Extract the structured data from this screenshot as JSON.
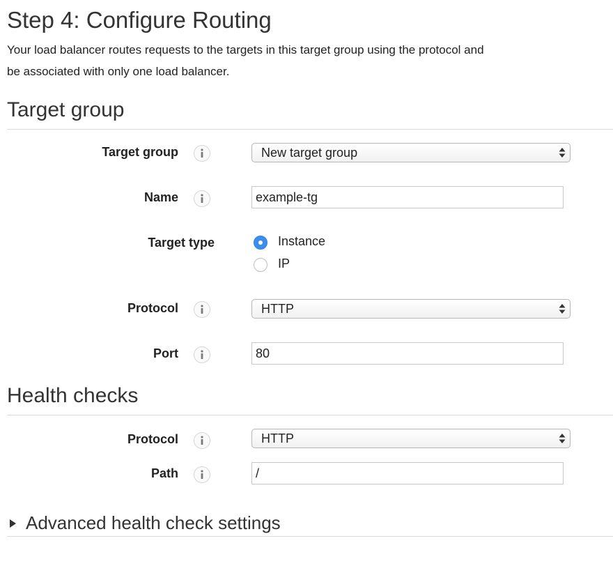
{
  "header": {
    "title": "Step 4: Configure Routing",
    "intro_line1": "Your load balancer routes requests to the targets in this target group using the protocol and",
    "intro_line2": "be associated with only one load balancer."
  },
  "target_group_section": {
    "title": "Target group",
    "target_group": {
      "label": "Target group",
      "value": "New target group"
    },
    "name": {
      "label": "Name",
      "value": "example-tg"
    },
    "target_type": {
      "label": "Target type",
      "options": [
        {
          "label": "Instance",
          "selected": true
        },
        {
          "label": "IP",
          "selected": false
        }
      ]
    },
    "protocol": {
      "label": "Protocol",
      "value": "HTTP"
    },
    "port": {
      "label": "Port",
      "value": "80"
    }
  },
  "health_checks_section": {
    "title": "Health checks",
    "protocol": {
      "label": "Protocol",
      "value": "HTTP"
    },
    "path": {
      "label": "Path",
      "value": "/"
    }
  },
  "advanced": {
    "label": "Advanced health check settings",
    "expanded": false
  },
  "icons": {
    "info": "info-icon",
    "select_arrows": "select-arrows-icon",
    "expand": "caret-right-icon"
  },
  "colors": {
    "accent": "#3b8ef0",
    "text": "#222222",
    "rule": "#d9d9d9"
  }
}
